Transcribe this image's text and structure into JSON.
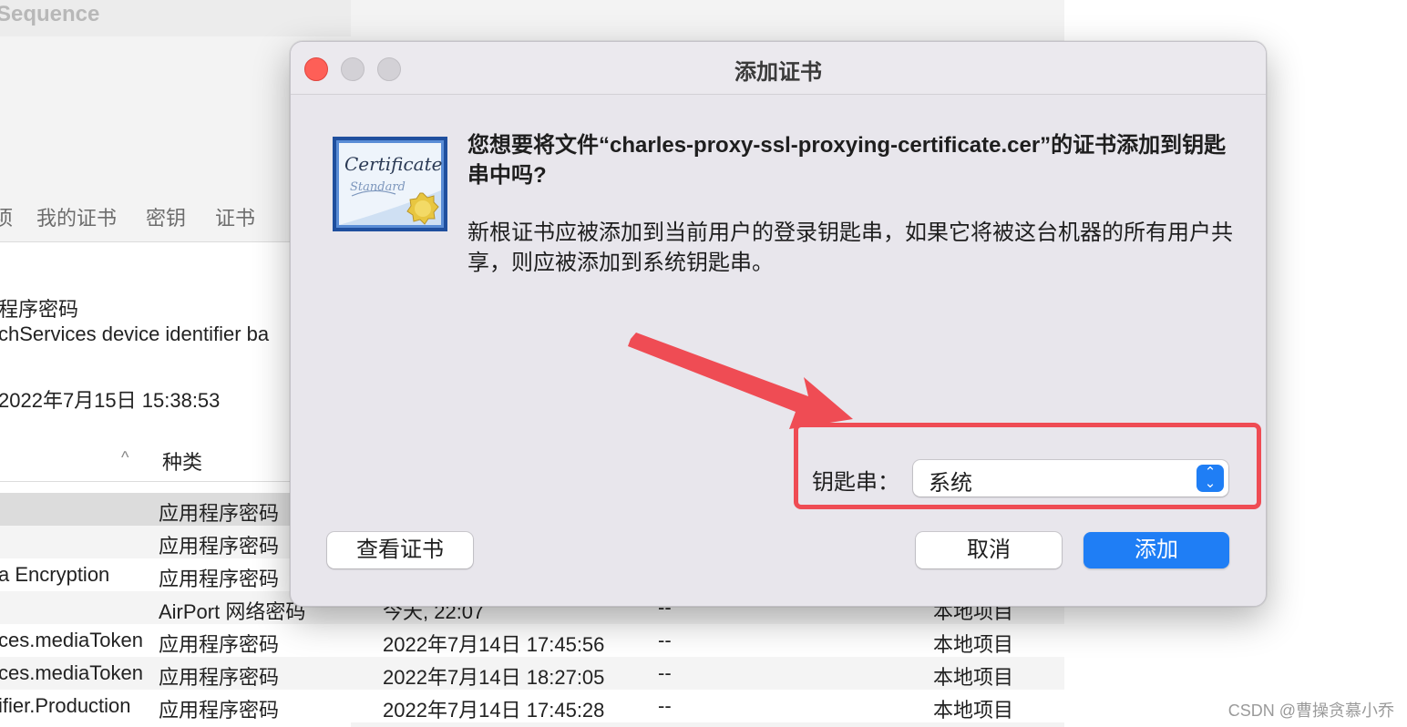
{
  "background_window": {
    "title": "Sequence",
    "tabs": [
      "项",
      "我的证书",
      "密钥",
      "证书"
    ],
    "info_kind": "程序密码",
    "info_where": "chServices device identifier ba",
    "info_date": "2022年7月15日 15:38:53",
    "sort_indicator": "^",
    "column_kind": "种类",
    "rows": [
      {
        "name": "",
        "kind": "应用程序密码",
        "date": "",
        "expires": "",
        "location": ""
      },
      {
        "name": "",
        "kind": "应用程序密码",
        "date": "",
        "expires": "",
        "location": ""
      },
      {
        "name": "a Encryption",
        "kind": "应用程序密码",
        "date": "",
        "expires": "",
        "location": ""
      },
      {
        "name": "",
        "kind": "AirPort 网络密码",
        "date": "今天, 22:07",
        "expires": "--",
        "location": "本地项目"
      },
      {
        "name": "ces.mediaToken",
        "kind": "应用程序密码",
        "date": "2022年7月14日 17:45:56",
        "expires": "--",
        "location": "本地项目"
      },
      {
        "name": "ces.mediaToken",
        "kind": "应用程序密码",
        "date": "2022年7月14日 18:27:05",
        "expires": "--",
        "location": "本地项目"
      },
      {
        "name": "ifier.Production",
        "kind": "应用程序密码",
        "date": "2022年7月14日 17:45:28",
        "expires": "--",
        "location": "本地项目"
      }
    ]
  },
  "dialog": {
    "title": "添加证书",
    "icon": "certificate-icon",
    "icon_text": "Certificate",
    "icon_subtext": "Standard",
    "message_title": "您想要将文件“charles-proxy-ssl-proxying-certificate.cer”的证书添加到钥匙串中吗?",
    "message_body": "新根证书应被添加到当前用户的登录钥匙串，如果它将被这台机器的所有用户共享，则应被添加到系统钥匙串。",
    "keychain_label": "钥匙串：",
    "keychain_value": "系统",
    "view_button": "查看证书",
    "cancel_button": "取消",
    "add_button": "添加"
  },
  "colors": {
    "accent": "#1f7ef5",
    "close": "#fe5f57",
    "annotation": "#ef4c54"
  },
  "watermark": "CSDN @曹操贪慕小乔"
}
